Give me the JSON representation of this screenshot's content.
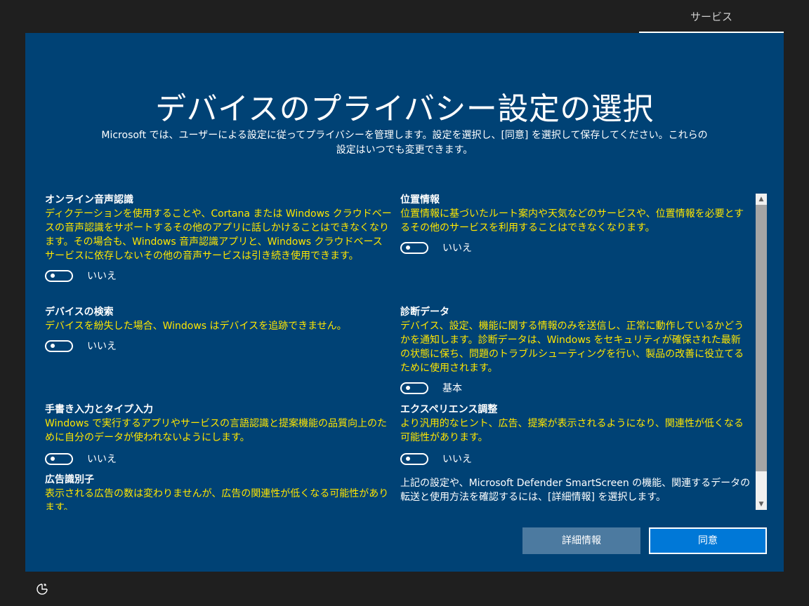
{
  "header": {
    "tab_label": "サービス"
  },
  "page": {
    "title": "デバイスのプライバシー設定の選択",
    "subtitle_line1": "Microsoft では、ユーザーによる設定に従ってプライバシーを管理します。設定を選択し、[同意] を選択して保存してください。これらの",
    "subtitle_line2": "設定はいつでも変更できます。"
  },
  "settings": {
    "speech": {
      "heading": "オンライン音声認識",
      "desc": "ディクテーションを使用することや、Cortana または Windows クラウドベースの音声認識をサポートするその他のアプリに話しかけることはできなくなります。その場合も、Windows 音声認識アプリと、Windows クラウドベース サービスに依存しないその他の音声サービスは引き続き使用できます。",
      "state": "いいえ"
    },
    "location": {
      "heading": "位置情報",
      "desc": "位置情報に基づいたルート案内や天気などのサービスや、位置情報を必要とするその他のサービスを利用することはできなくなります。",
      "state": "いいえ"
    },
    "find_device": {
      "heading": "デバイスの検索",
      "desc": "デバイスを紛失した場合、Windows はデバイスを追跡できません。",
      "state": "いいえ"
    },
    "diagnostics": {
      "heading": "診断データ",
      "desc": "デバイス、設定、機能に関する情報のみを送信し、正常に動作しているかどうかを通知します。診断データは、Windows をセキュリティが確保された最新の状態に保ち、問題のトラブルシューティングを行い、製品の改善に役立てるために使用されます。",
      "state": "基本"
    },
    "inking": {
      "heading": "手書き入力とタイプ入力",
      "desc": "Windows で実行するアプリやサービスの言語認識と提案機能の品質向上のために自分のデータが使われないようにします。",
      "state": "いいえ"
    },
    "experience": {
      "heading": "エクスペリエンス調整",
      "desc": "より汎用的なヒント、広告、提案が表示されるようになり、関連性が低くなる可能性があります。",
      "state": "いいえ"
    },
    "ad_id": {
      "heading": "広告識別子",
      "desc": "表示される広告の数は変わりませんが、広告の関連性が低くなる可能性があります。"
    }
  },
  "footer_note": "上記の設定や、Microsoft Defender SmartScreen の機能、関連するデータの転送と使用方法を確認するには、[詳細情報] を選択します。",
  "buttons": {
    "details": "詳細情報",
    "agree": "同意"
  },
  "colors": {
    "panel": "#004275",
    "accent": "#0078d7",
    "desc_text": "#ffe600"
  },
  "icons": {
    "accessibility": "ease-of-access-icon"
  }
}
